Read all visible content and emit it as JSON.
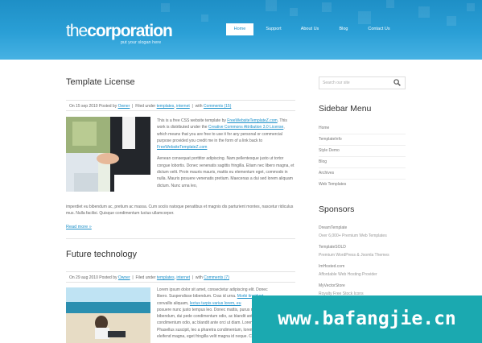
{
  "header": {
    "logo_light": "the",
    "logo_bold": "corporation",
    "slogan": "put your slogan here",
    "nav": [
      "Home",
      "Support",
      "About Us",
      "Blog",
      "Contact Us"
    ],
    "active_nav": "Home"
  },
  "posts": [
    {
      "title": "Template License",
      "meta": {
        "date": "On 15 sep 2010 Posted by",
        "author": "Owner",
        "filed": "Filed under",
        "category1": "templates",
        "category2": "internet",
        "with": "with",
        "comments": "Comments (15)"
      },
      "image": "handshake-photo",
      "para1": [
        {
          "t": "This is a free CSS website template by "
        },
        {
          "t": "FreeWebsiteTemplateZ.com",
          "link": true
        },
        {
          "t": ". This work is distributed under the "
        },
        {
          "t": "Creative Commons Attribution 3.0 License",
          "link": true
        },
        {
          "t": ", which means that you are free to use it for any personal or commercial purpose provided you credit me in the form of a link back to "
        },
        {
          "t": "FreeWebsiteTemplateZ.com",
          "link": true
        }
      ],
      "para2_wrap": "Aenean consequat porttitor adipiscing. Nam pellentesque justo ut tortor congue lobortis. Donec venenatis sagittis fringilla. Etiam nec libero magna, et dictum velit. Proin mauris mauris, mattis eu elementum eget, commodo in nulla. Mauris posuere venenatis pretium. Maecenas a dui sed lorem aliquam dictum. Nunc urna leo,",
      "para2_full": "imperdiet eu bibendum ac, pretium ac massa. Cum sociis natoque penatibus et magnis dis parturient montes, nascetur ridiculus mus. Nulla facilisi. Quisque condimentum luctus ullamcorper.",
      "read_more": "Read more »"
    },
    {
      "title": "Future technology",
      "meta": {
        "date": "On 29 aug 2010 Posted by",
        "author": "Owner",
        "filed": "Filed under",
        "category1": "templates",
        "category2": "internet",
        "with": "with",
        "comments": "Comments (7)"
      },
      "image": "beach-laptop-photo",
      "para_lines": [
        [
          {
            "t": "Lorem ipsum dolor sit amet, consectetur adipiscing elit. Donec"
          }
        ],
        [
          {
            "t": "libero. Suspendisse bibendum. Cras id urna. "
          },
          {
            "t": "Morbi tincidunt",
            "link": true
          }
        ],
        [
          {
            "t": "convallis aliquam, "
          },
          {
            "t": "lectus turpis varius lorem, eu",
            "link": true
          }
        ],
        [
          {
            "t": "posuere nunc justo tempus leo. Donec mattis, purus nec placerat"
          }
        ],
        [
          {
            "t": "bibendum, dui pede condimentum odio, ac blandit ante orci ut diam."
          }
        ],
        [
          {
            "t": "condimentum odio, ac blandit ante orci ut diam. Lorem ipsum dolor sit"
          }
        ],
        [
          {
            "t": "Phasellus suscipit, leo a pharetra condimentum, lorem tellus"
          }
        ],
        [
          {
            "t": "eleifend magna, eget fringilla velit magna id neque. Curabitur"
          }
        ]
      ]
    }
  ],
  "sidebar": {
    "search_placeholder": "Search our site",
    "menu_title": "Sidebar Menu",
    "menu_items": [
      "Home",
      "TemplateInfo",
      "Style Demo",
      "Blog",
      "Archives",
      "Web Templates"
    ],
    "sponsors_title": "Sponsors",
    "sponsors": [
      {
        "name": "DreamTemplate",
        "desc": "Over 6,000+ Premium Web Templates"
      },
      {
        "name": "TemplateSOLD",
        "desc": "Premium WordPress & Joomla Themes"
      },
      {
        "name": "ImHosted.com",
        "desc": "Affordable Web Hosting Provider"
      },
      {
        "name": "MyVectorStore",
        "desc": "Royalty Free Stock Icons"
      }
    ]
  },
  "watermark": "www.bafangjie.cn",
  "colors": {
    "header_blue": "#2a9fd6",
    "link_blue": "#1a8fc9",
    "watermark_teal": "#1ba9b0"
  }
}
